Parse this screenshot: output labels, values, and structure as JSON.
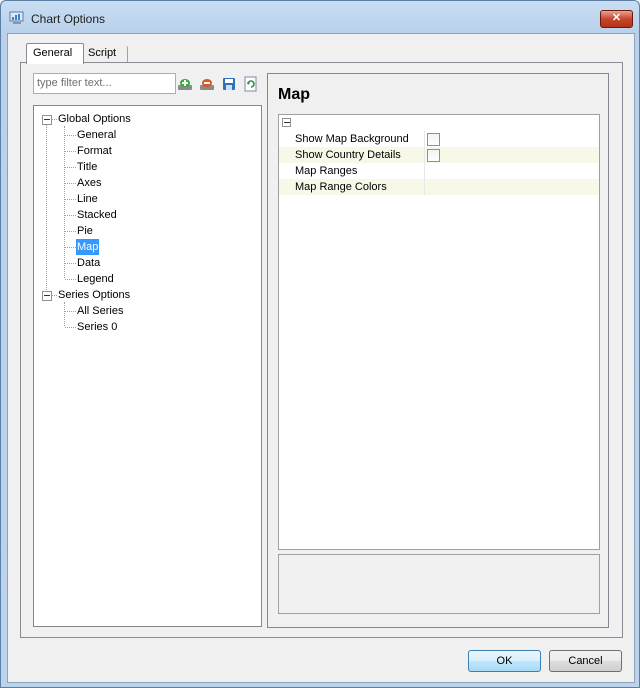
{
  "window": {
    "title": "Chart Options"
  },
  "tabs": [
    {
      "label": "General"
    },
    {
      "label": "Script"
    }
  ],
  "filter": {
    "placeholder": "type filter text..."
  },
  "toolbar": {
    "icons": [
      "add-icon",
      "remove-icon",
      "save-icon",
      "refresh-icon"
    ]
  },
  "tree": {
    "global": {
      "label": "Global Options",
      "children": [
        "General",
        "Format",
        "Title",
        "Axes",
        "Line",
        "Stacked",
        "Pie",
        "Map",
        "Data",
        "Legend"
      ]
    },
    "series": {
      "label": "Series Options",
      "children": [
        "All Series",
        "Series 0"
      ]
    },
    "selected": "Map"
  },
  "page": {
    "title": "Map"
  },
  "properties": [
    {
      "label": "Show Map Background",
      "type": "checkbox",
      "checked": false
    },
    {
      "label": "Show Country Details",
      "type": "checkbox",
      "checked": false
    },
    {
      "label": "Map Ranges",
      "type": "text",
      "value": ""
    },
    {
      "label": "Map Range Colors",
      "type": "text",
      "value": ""
    }
  ],
  "buttons": {
    "ok": "OK",
    "cancel": "Cancel"
  },
  "colors": {
    "selection": "#3399ff",
    "alt_row": "#f8f8e8",
    "close": "#c7452d"
  }
}
